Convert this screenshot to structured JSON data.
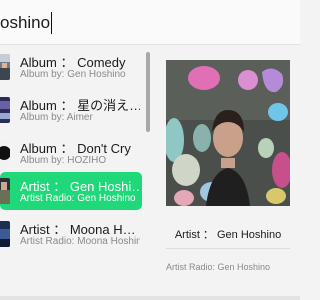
{
  "search": {
    "query": "oshino"
  },
  "results": [
    {
      "title": "Album ： Comedy",
      "subtitle": "Album by: Gen Hoshino",
      "selected": false
    },
    {
      "title": "Album ： 星の消え…",
      "subtitle": "Album by: Aimer",
      "selected": false
    },
    {
      "title": "Album ： Don't Cry",
      "subtitle": "Album by: HOZIHO",
      "selected": false
    },
    {
      "title": "Artist ： Gen Hoshi…",
      "subtitle": "Artist Radio: Gen Hoshino",
      "selected": true
    },
    {
      "title": "Artist ： Moona H…",
      "subtitle": "Artist Radio: Moona Hoshino",
      "selected": false
    }
  ],
  "detail": {
    "title": "Artist ： Gen Hoshino",
    "subtitle": "Artist Radio: Gen Hoshino"
  },
  "colors": {
    "selected_bg": "#1fd87a",
    "window_bg": "#f3f3f3"
  }
}
